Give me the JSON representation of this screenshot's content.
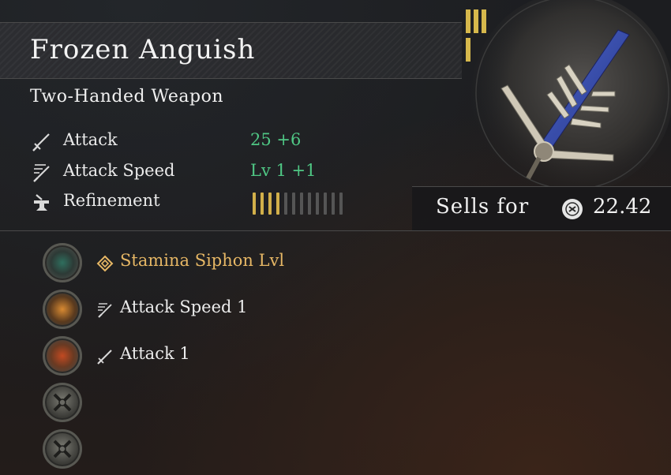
{
  "item": {
    "name": "Frozen Anguish",
    "type": "Two-Handed Weapon",
    "tier_marker": "III"
  },
  "stats": [
    {
      "icon": "sword-icon",
      "label": "Attack",
      "value": "25 +6"
    },
    {
      "icon": "attack-speed-icon",
      "label": "Attack Speed",
      "value": "Lv 1 +1"
    },
    {
      "icon": "anvil-icon",
      "label": "Refinement",
      "value": ""
    }
  ],
  "refinement": {
    "filled": 4,
    "total": 12
  },
  "sell": {
    "label": "Sells for",
    "value": "22.42",
    "icon": "coin-icon"
  },
  "runes": [
    {
      "icon": "rune-diamond-icon",
      "label": "Stamina Siphon Lvl",
      "highlight": true
    },
    {
      "icon": "attack-speed-icon",
      "label": "Attack Speed 1",
      "highlight": false
    },
    {
      "icon": "sword-icon",
      "label": "Attack 1",
      "highlight": false
    },
    {
      "icon": "",
      "label": "",
      "highlight": false
    },
    {
      "icon": "",
      "label": "",
      "highlight": false
    }
  ],
  "colors": {
    "value_green": "#4fc784",
    "rune_gold": "#e6b765",
    "refinement_filled": "#d2b04a",
    "refinement_empty": "#555555"
  }
}
